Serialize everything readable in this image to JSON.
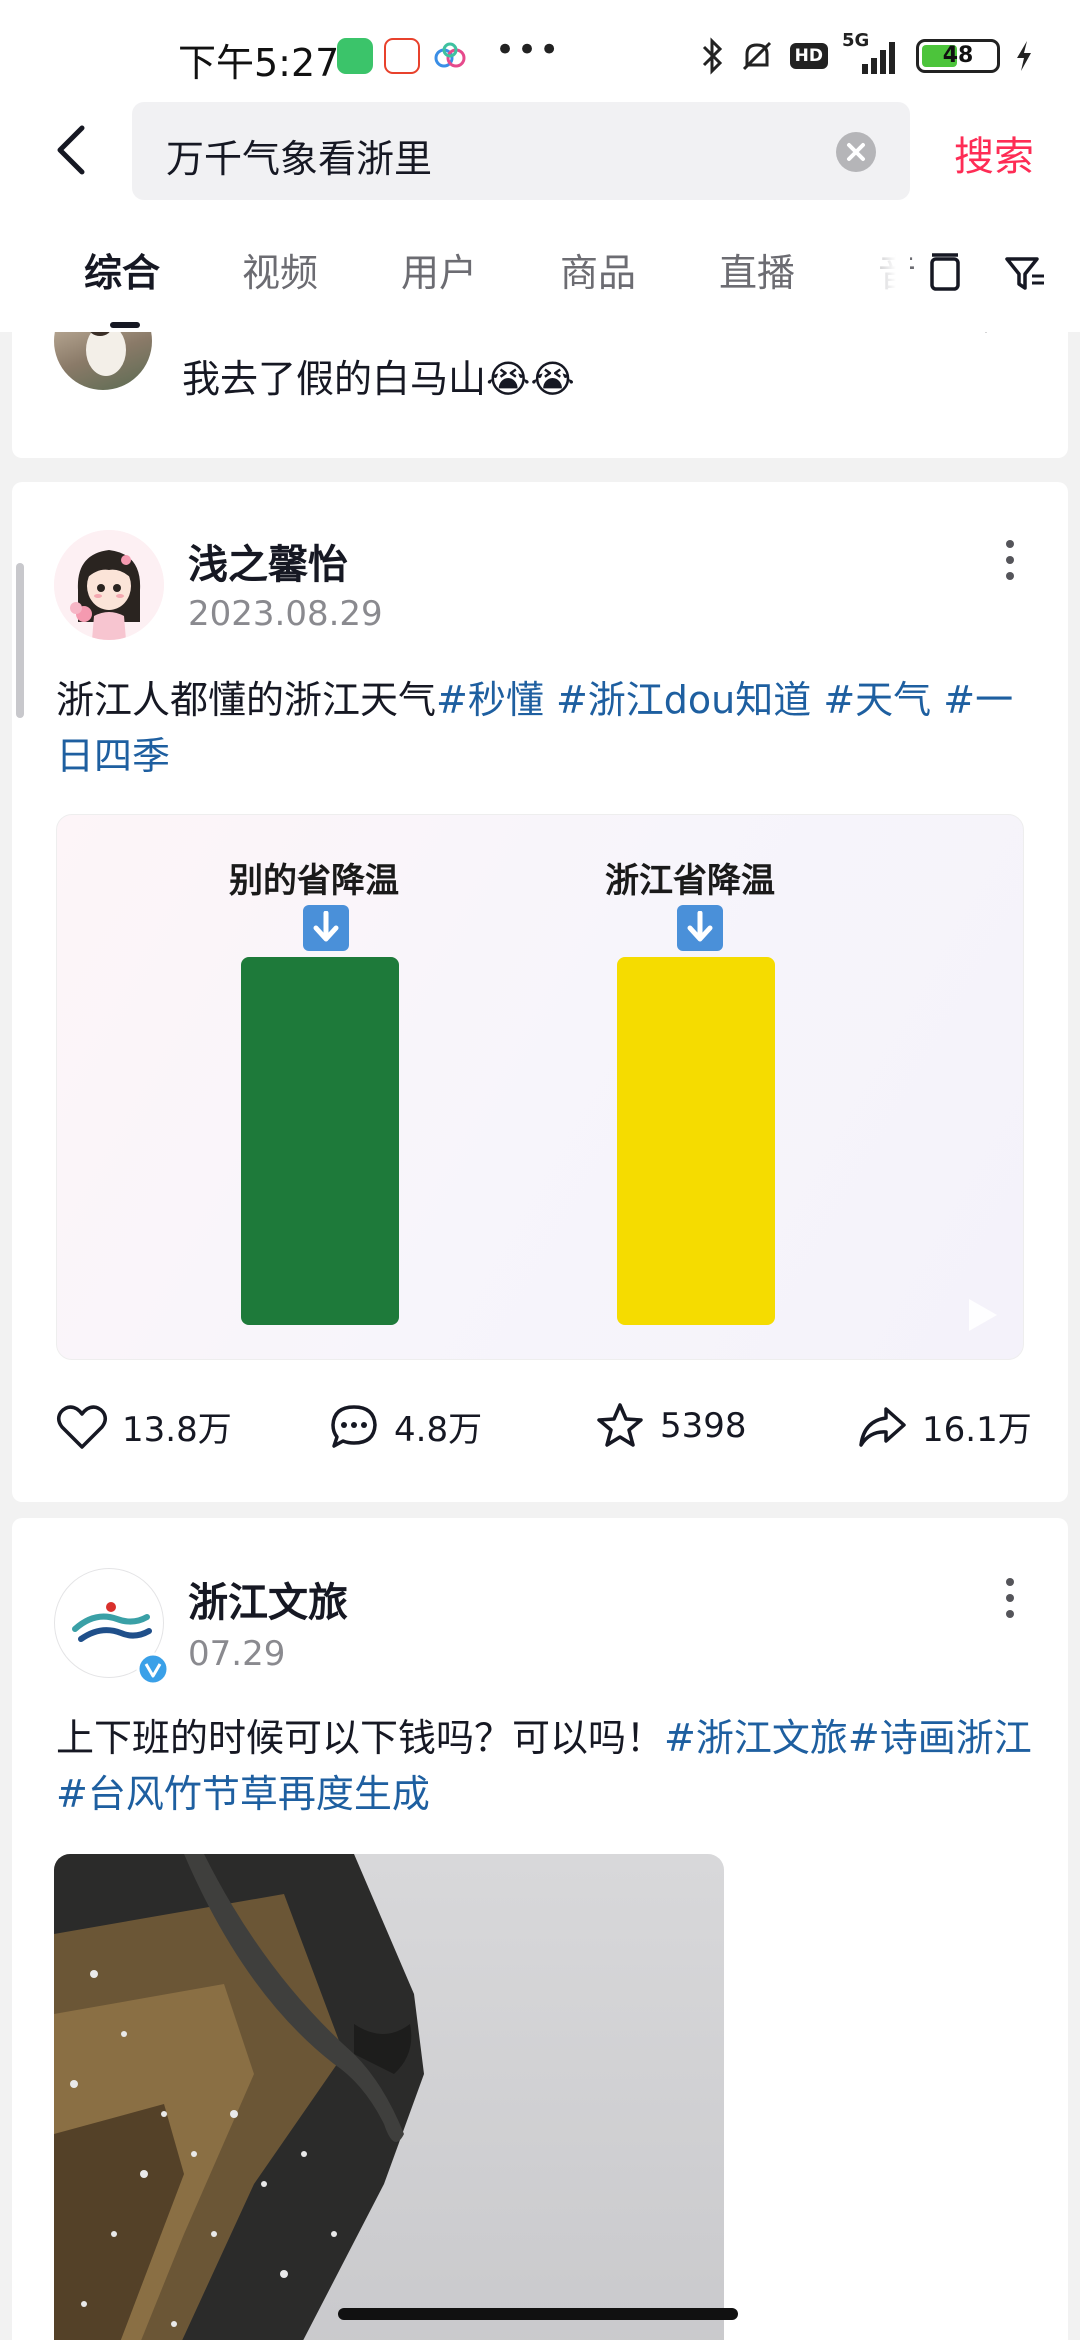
{
  "status_bar": {
    "time": "下午5:27",
    "network": "5G",
    "hd_badge": "HD",
    "battery": "48",
    "battery_level": 0.48,
    "notification_apps": [
      "wechat-icon",
      "58-app-icon",
      "cloud-app-icon"
    ]
  },
  "search": {
    "query": "万千气象看浙里",
    "search_label": "搜索"
  },
  "tabs": [
    {
      "label": "综合",
      "active": true
    },
    {
      "label": "视频",
      "active": false
    },
    {
      "label": "用户",
      "active": false
    },
    {
      "label": "商品",
      "active": false
    },
    {
      "label": "直播",
      "active": false
    },
    {
      "label": "音",
      "active": false
    }
  ],
  "prev_comment": {
    "text": "我去了假的白马山😭😭"
  },
  "post1": {
    "author": "浅之馨怡",
    "date": "2023.08.29",
    "text_plain": "浙江人都懂的浙江天气",
    "hashtags": [
      "#秒懂",
      "#浙江dou知道",
      "#天气",
      "#一日四季"
    ],
    "media": {
      "left_label": "别的省降温",
      "right_label": "浙江省降温",
      "left_color": "#1e7a3a",
      "right_color": "#f5dc00"
    },
    "stats": {
      "likes": "13.8万",
      "comments": "4.8万",
      "favorites": "5398",
      "shares": "16.1万"
    }
  },
  "post2": {
    "author": "浙江文旅",
    "date": "07.29",
    "text_plain": "上下班的时候可以下钱吗？可以吗！",
    "hashtags": [
      "#浙江文旅",
      "#诗画浙江",
      "#台风竹节草再度生成"
    ]
  },
  "colors": {
    "accent": "#fe2c55",
    "hashtag": "#1e5fa0",
    "verified": "#3aa0e8"
  }
}
